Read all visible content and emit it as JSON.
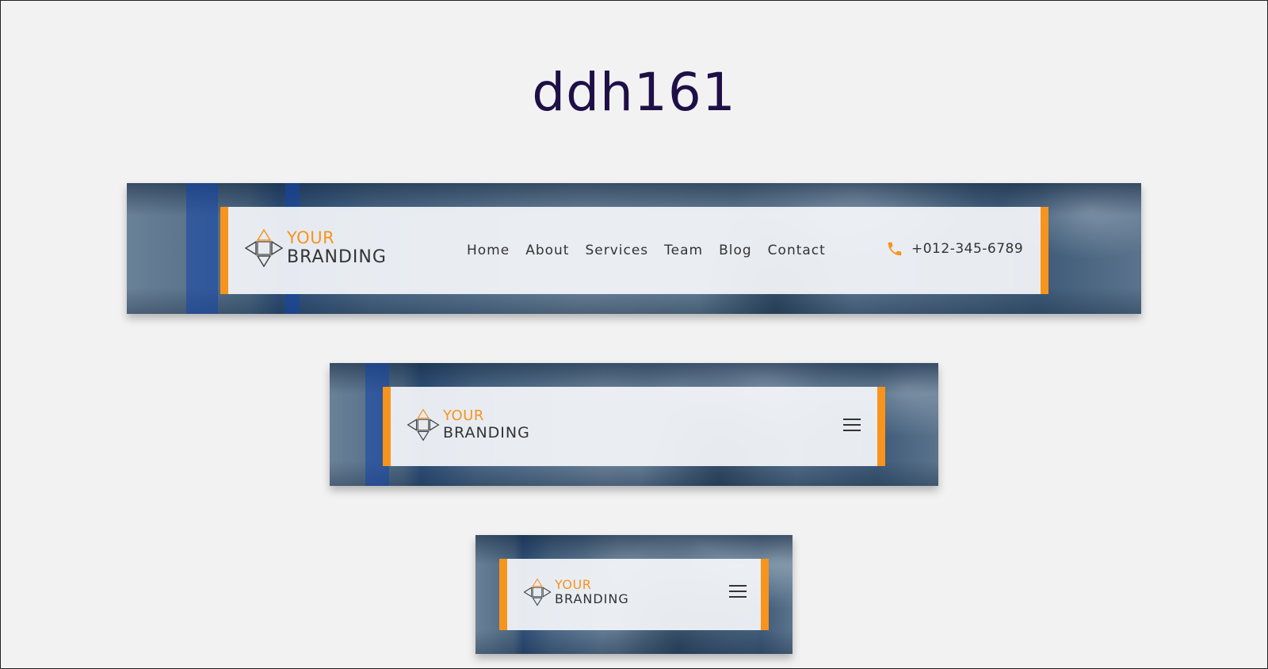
{
  "page": {
    "title": "ddh161"
  },
  "brand": {
    "line1": "YOUR",
    "line2": "BRANDING"
  },
  "nav": {
    "items": [
      {
        "label": "Home"
      },
      {
        "label": "About"
      },
      {
        "label": "Services"
      },
      {
        "label": "Team"
      },
      {
        "label": "Blog"
      },
      {
        "label": "Contact"
      }
    ]
  },
  "contact": {
    "phone": "+012-345-6789"
  },
  "colors": {
    "accent": "#f7941d",
    "title": "#1e0f47",
    "text": "#333333",
    "background": "#f2f2f2",
    "banner": "#4d6883"
  },
  "icons": {
    "phone": "phone-icon",
    "menu": "hamburger-menu-icon",
    "logo": "diamond-arrows-logo-icon"
  }
}
